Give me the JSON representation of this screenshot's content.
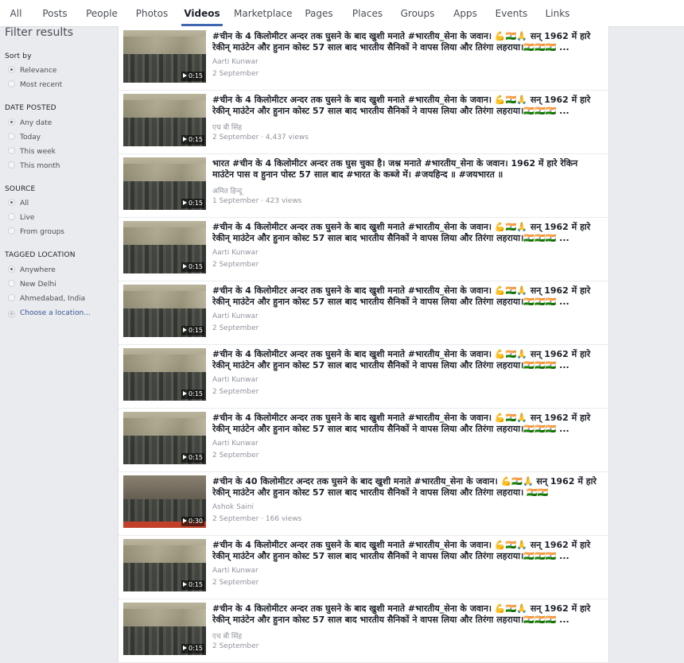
{
  "nav": {
    "tabs": [
      "All",
      "Posts",
      "People",
      "Photos",
      "Videos",
      "Marketplace",
      "Pages",
      "Places",
      "Groups",
      "Apps",
      "Events",
      "Links"
    ],
    "active": "Videos"
  },
  "filters": {
    "title": "Filter results",
    "sort_by": {
      "label": "Sort by",
      "options": [
        "Relevance",
        "Most recent"
      ],
      "selected": "Relevance"
    },
    "date_posted": {
      "label": "DATE POSTED",
      "options": [
        "Any date",
        "Today",
        "This week",
        "This month"
      ],
      "selected": "Any date"
    },
    "source": {
      "label": "SOURCE",
      "options": [
        "All",
        "Live",
        "From groups"
      ],
      "selected": "All"
    },
    "tagged_location": {
      "label": "TAGGED LOCATION",
      "options": [
        "Anywhere",
        "New Delhi",
        "Ahmedabad, India"
      ],
      "selected": "Anywhere",
      "choose": "Choose a location..."
    }
  },
  "results": [
    {
      "title": "#चीन के 4 किलोमीटर अन्दर तक घुसने के बाद खुशी मनाते #भारतीय_सेना के जवान। 💪🇮🇳🙏 सन् 1962 में हारे रेकीन् माउंटेन और हुनान कोस्ट 57 साल बाद भारतीय सैनिकों ने वापस लिया और तिरंगा लहराया।🇮🇳🇮🇳🇮🇳 ...",
      "author": "Aarti Kunwar",
      "meta": "2 September",
      "duration": "0:15"
    },
    {
      "title": "#चीन के 4 किलोमीटर अन्दर तक घुसने के बाद खुशी मनाते #भारतीय_सेना के जवान। 💪🇮🇳🙏 सन् 1962 में हारे रेकीन् माउंटेन और हुनान कोस्ट 57 साल बाद भारतीय सैनिकों ने वापस लिया और तिरंगा लहराया।🇮🇳🇮🇳🇮🇳 ...",
      "author": "एच बी सिंह",
      "meta": "2 September · 4,437 views",
      "duration": "0:15"
    },
    {
      "title": "भारत #चीन के 4 किलोमीटर अन्दर तक घुस चुका है। जश्न मनाते #भारतीय_सेना के जवान। 1962 में हारे रेकिन माउंटेन पास व हुनान पोस्ट 57 साल बाद #भारत के कब्जे में। #जयहिन्द ॥ #जयभारत ॥",
      "author": "अमित हिन्दू",
      "meta": "1 September · 423 views",
      "duration": "0:15"
    },
    {
      "title": "#चीन के 4 किलोमीटर अन्दर तक घुसने के बाद खुशी मनाते #भारतीय_सेना के जवान। 💪🇮🇳🙏 सन् 1962 में हारे रेकीन् माउंटेन और हुनान कोस्ट 57 साल बाद भारतीय सैनिकों ने वापस लिया और तिरंगा लहराया।🇮🇳🇮🇳🇮🇳 ...",
      "author": "Aarti Kunwar",
      "meta": "2 September",
      "duration": "0:15"
    },
    {
      "title": "#चीन के 4 किलोमीटर अन्दर तक घुसने के बाद खुशी मनाते #भारतीय_सेना के जवान। 💪🇮🇳🙏 सन् 1962 में हारे रेकीन् माउंटेन और हुनान कोस्ट 57 साल बाद भारतीय सैनिकों ने वापस लिया और तिरंगा लहराया।🇮🇳🇮🇳🇮🇳 ...",
      "author": "Aarti Kunwar",
      "meta": "2 September",
      "duration": "0:15"
    },
    {
      "title": "#चीन के 4 किलोमीटर अन्दर तक घुसने के बाद खुशी मनाते #भारतीय_सेना के जवान। 💪🇮🇳🙏 सन् 1962 में हारे रेकीन् माउंटेन और हुनान कोस्ट 57 साल बाद भारतीय सैनिकों ने वापस लिया और तिरंगा लहराया।🇮🇳🇮🇳🇮🇳 ...",
      "author": "Aarti Kunwar",
      "meta": "2 September",
      "duration": "0:15"
    },
    {
      "title": "#चीन के 4 किलोमीटर अन्दर तक घुसने के बाद खुशी मनाते #भारतीय_सेना के जवान। 💪🇮🇳🙏 सन् 1962 में हारे रेकीन् माउंटेन और हुनान कोस्ट 57 साल बाद भारतीय सैनिकों ने वापस लिया और तिरंगा लहराया।🇮🇳🇮🇳🇮🇳 ...",
      "author": "Aarti Kunwar",
      "meta": "2 September",
      "duration": "0:15"
    },
    {
      "title": "#चीन के 40 किलोमीटर अन्दर तक घुसने के बाद खुशी मनाते #भारतीय_सेना के जवान। 💪🇮🇳🙏 सन् 1962 में हारे रेकीन् माउंटेन और हुनान कोस्ट 57 साल बाद भारतीय सैनिकों ने वापस लिया और तिरंगा लहराया। 🇮🇳🇮🇳",
      "author": "Ashok Saini",
      "meta": "2 September · 166 views",
      "duration": "0:30"
    },
    {
      "title": "#चीन के 4 किलोमीटर अन्दर तक घुसने के बाद खुशी मनाते #भारतीय_सेना के जवान। 💪🇮🇳🙏 सन् 1962 में हारे रेकीन् माउंटेन और हुनान कोस्ट 57 साल बाद भारतीय सैनिकों ने वापस लिया और तिरंगा लहराया।🇮🇳🇮🇳🇮🇳 ...",
      "author": "Aarti Kunwar",
      "meta": "2 September",
      "duration": "0:15"
    },
    {
      "title": "#चीन के 4 किलोमीटर अन्दर तक घुसने के बाद खुशी मनाते #भारतीय_सेना के जवान। 💪🇮🇳🙏 सन् 1962 में हारे रेकीन् माउंटेन और हुनान कोस्ट 57 साल बाद भारतीय सैनिकों ने वापस लिया और तिरंगा लहराया।🇮🇳🇮🇳🇮🇳 ...",
      "author": "एच बी सिंह",
      "meta": "2 September",
      "duration": "0:15"
    }
  ]
}
